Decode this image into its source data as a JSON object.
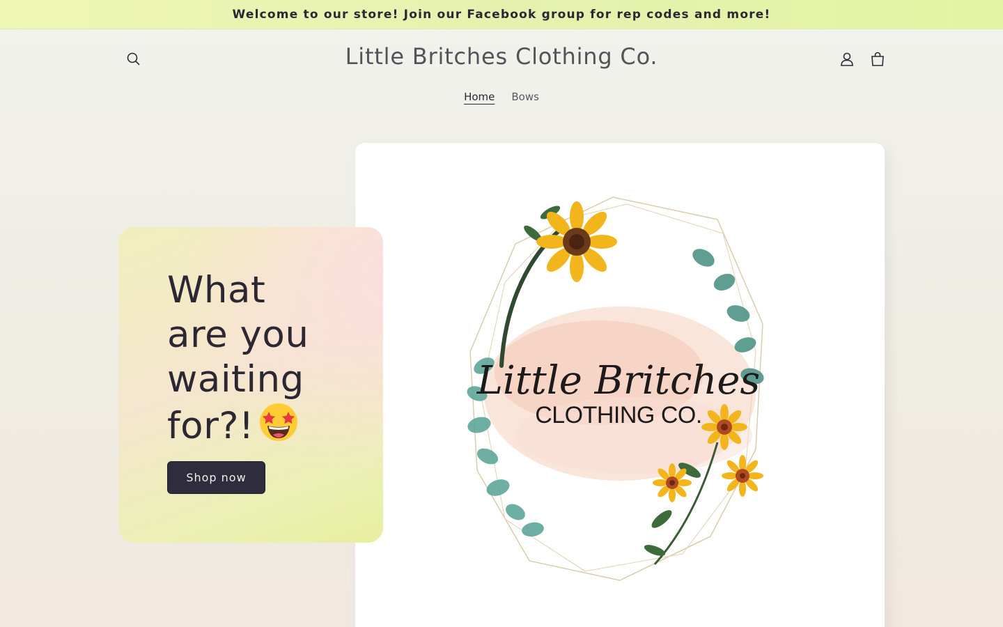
{
  "announcement": {
    "text": "Welcome to our store! Join our Facebook group for rep codes and more!"
  },
  "header": {
    "logo": "Little Britches Clothing Co.",
    "icons": [
      "search-icon",
      "account-icon",
      "cart-icon"
    ]
  },
  "nav": {
    "items": [
      {
        "label": "Home",
        "active": true
      },
      {
        "label": "Bows",
        "active": false
      }
    ]
  },
  "hero": {
    "heading_lines": [
      "What",
      "are you",
      "waiting",
      "for?!"
    ],
    "emoji": "star-struck-emoji",
    "button_label": "Shop now",
    "image_logo": {
      "title": "Little Britches",
      "subtitle": "CLOTHING CO."
    }
  },
  "colors": {
    "announcement_bg": "#e6f1b0",
    "text_dark": "#2b2833",
    "button_bg": "#2f2c3d",
    "button_text": "#f2f0e6",
    "sunflower": "#f2b51c",
    "eucalyptus": "#5fa79a"
  }
}
